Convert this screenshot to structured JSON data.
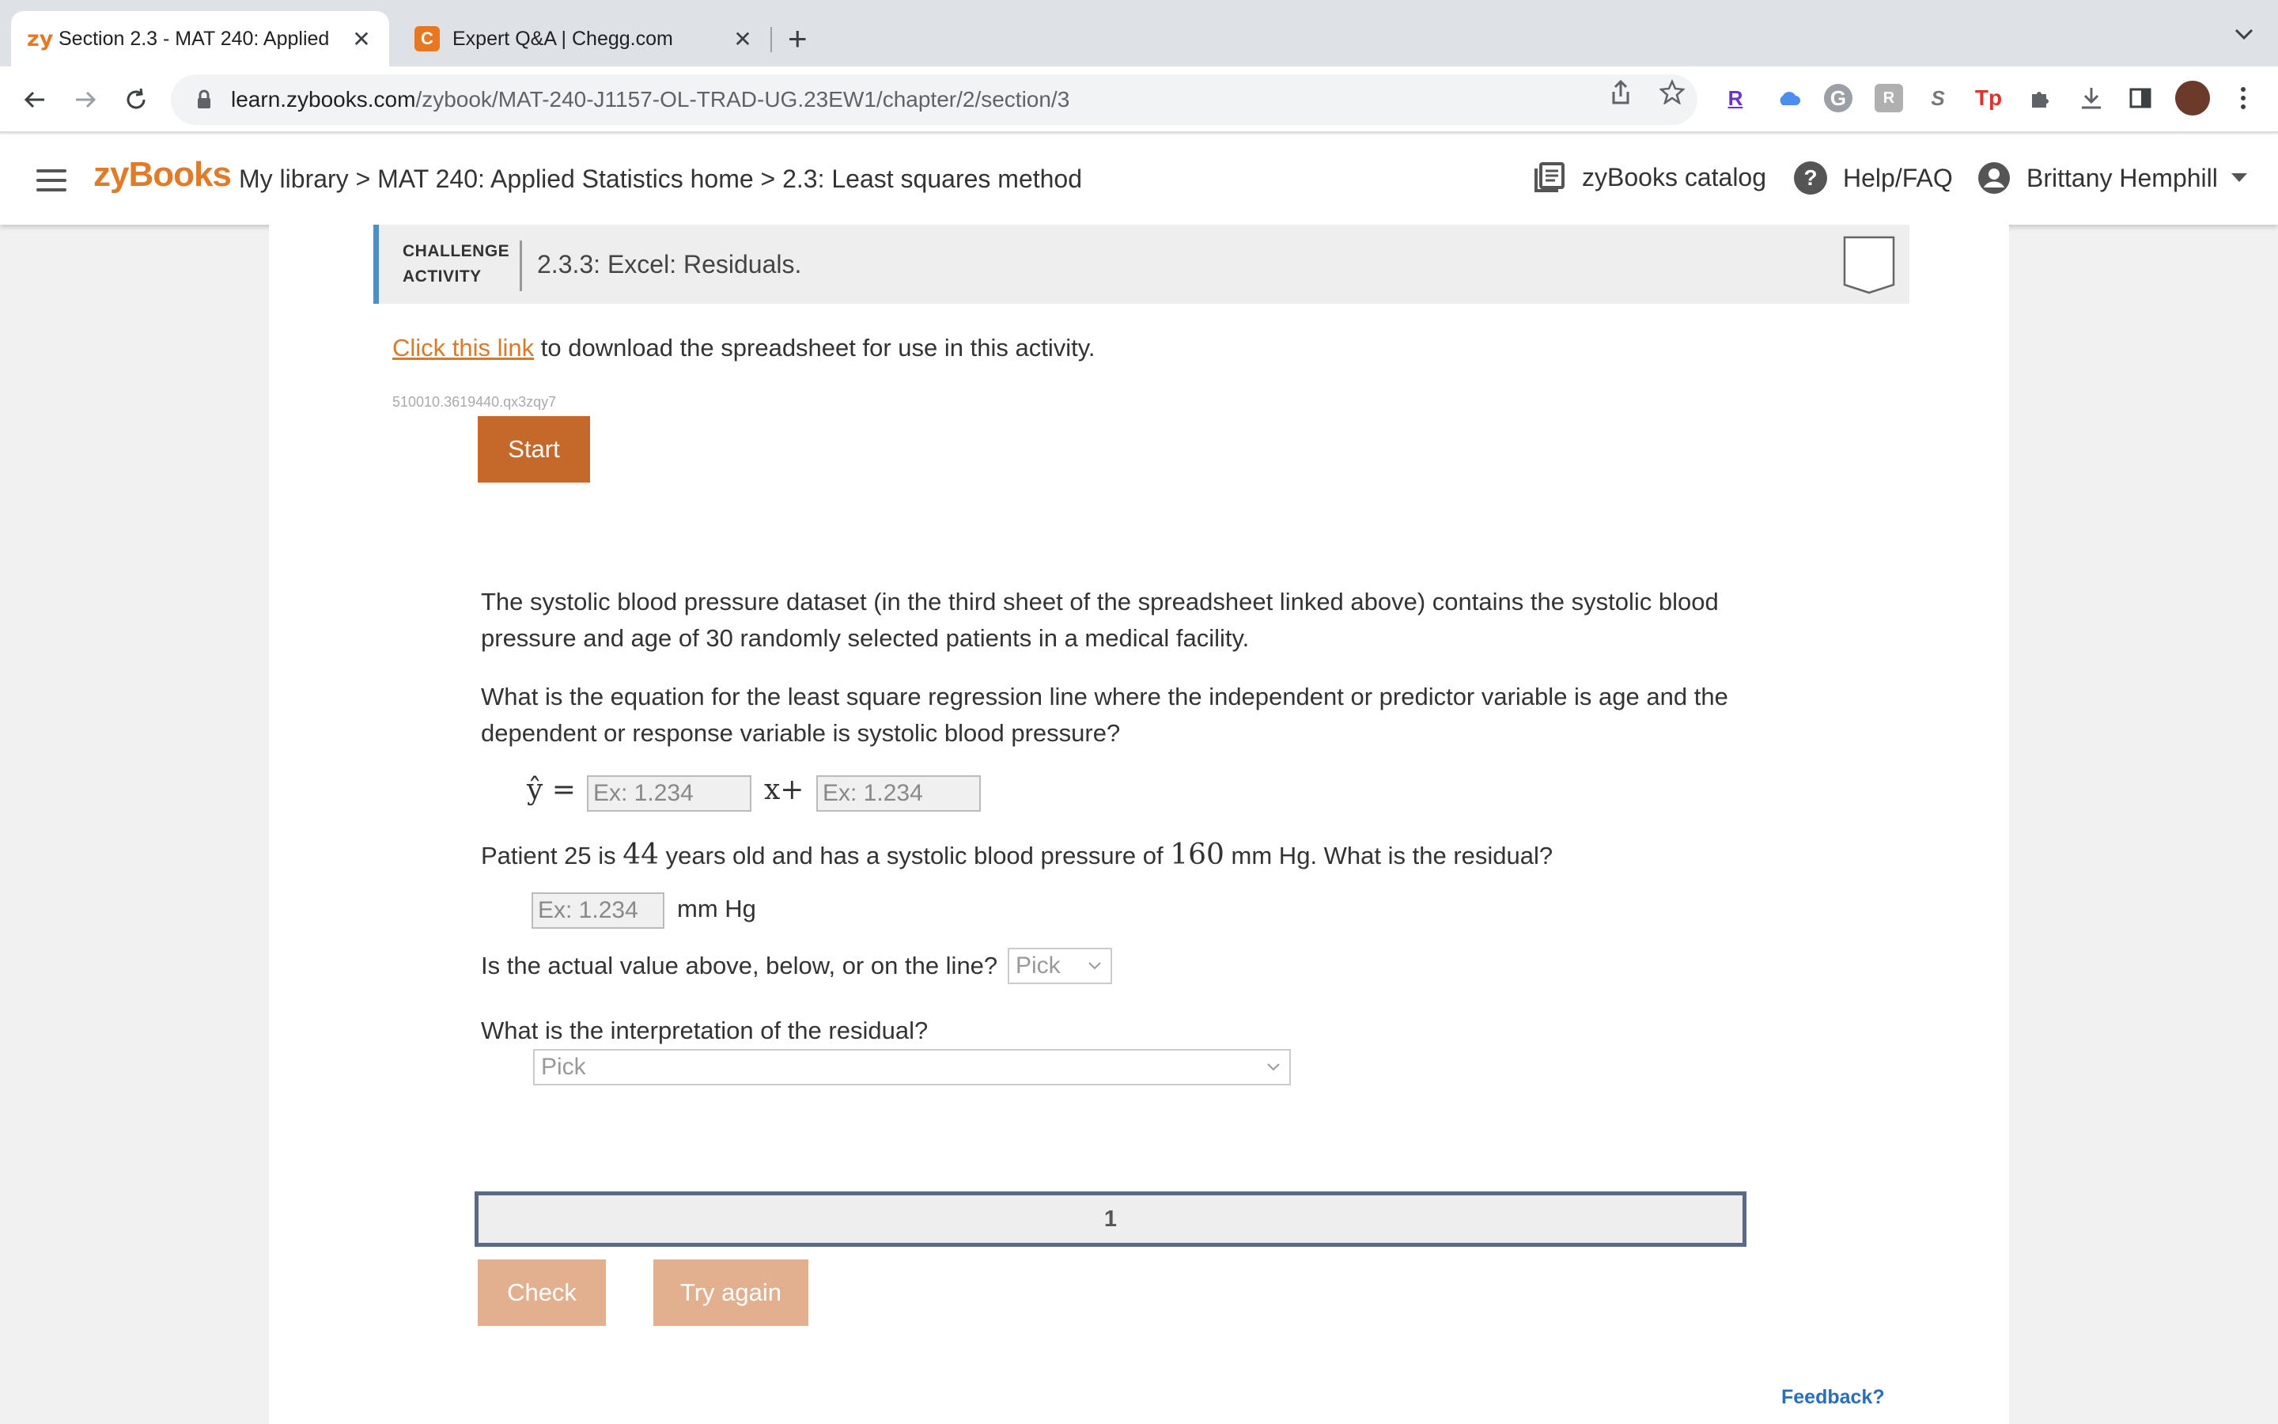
{
  "browser": {
    "tabs": [
      {
        "favicon": "zy",
        "title": "Section 2.3 - MAT 240: Applied",
        "close": "✕"
      },
      {
        "favicon": "C",
        "title": "Expert Q&A | Chegg.com",
        "close": "✕"
      }
    ],
    "new_tab": "+",
    "url_host": "learn.zybooks.com",
    "url_path": "/zybook/MAT-240-J1157-OL-TRAD-UG.23EW1/chapter/2/section/3",
    "extensions": [
      "R",
      "G",
      "S",
      "Tp"
    ]
  },
  "header": {
    "logo": "zyBooks",
    "breadcrumb": "My library > MAT 240: Applied Statistics home > 2.3: Least squares method",
    "catalog": "zyBooks catalog",
    "help": "Help/FAQ",
    "user": "Brittany Hemphill"
  },
  "activity": {
    "label_line1": "CHALLENGE",
    "label_line2": "ACTIVITY",
    "title": "2.3.3: Excel: Residuals.",
    "link_text": "Click this link",
    "link_rest": " to download the spreadsheet for use in this activity.",
    "id": "510010.3619440.qx3zqy7",
    "start": "Start"
  },
  "question": {
    "intro": "The systolic blood pressure dataset (in the third sheet of the spreadsheet linked above) contains the systolic blood pressure and age of 30 randomly selected patients in a medical facility.",
    "q1": "What is the equation for the least square regression line where the independent or predictor variable is age and the dependent or response variable is systolic blood pressure?",
    "eq_lhs": "ŷ =",
    "eq_mid": "x+",
    "placeholder": "Ex: 1.234",
    "q2_a": "Patient 25 is ",
    "q2_age": "44",
    "q2_b": " years old and has a systolic blood pressure of ",
    "q2_bp": "160",
    "q2_c": " mm Hg. What is the residual?",
    "unit": "mm Hg",
    "q3": "Is the actual value above, below, or on the line?",
    "q4": "What is the interpretation of the residual?",
    "pick": "Pick"
  },
  "footer": {
    "level": "1",
    "check": "Check",
    "try_again": "Try again",
    "feedback": "Feedback?"
  }
}
